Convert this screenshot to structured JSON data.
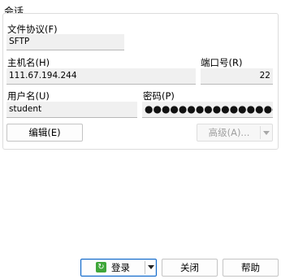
{
  "session": {
    "group_title": "会话",
    "protocol_label": "文件协议(F)",
    "protocol_value": "SFTP",
    "host_label": "主机名(H)",
    "host_value": "111.67.194.244",
    "port_label": "端口号(R)",
    "port_value": "22",
    "user_label": "用户名(U)",
    "user_value": "student",
    "password_label": "密码(P)",
    "password_value": "●●●●●●●●●●●●●●●●●",
    "edit_button": "编辑(E)",
    "advanced_button": "高级(A)..."
  },
  "footer": {
    "login_button": "登录",
    "close_button": "关闭",
    "help_button": "帮助"
  },
  "icons": {
    "login": "login-arrows-icon",
    "dropdown": "chevron-down-icon"
  },
  "colors": {
    "field_bg": "#f0f0f0",
    "login_icon": "#3fa63a",
    "focus_border": "#0a64c8"
  }
}
